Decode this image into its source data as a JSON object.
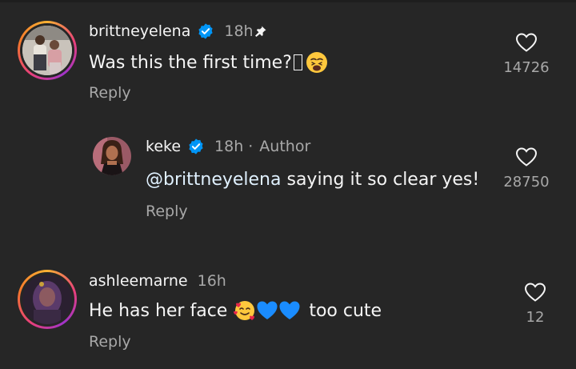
{
  "comments": [
    {
      "username": "brittneyelena",
      "verified": true,
      "time": "18h",
      "pinned": true,
      "text": "Was this the first time?",
      "reply_label": "Reply",
      "likes": "14726"
    },
    {
      "username": "keke",
      "verified": true,
      "time": "18h",
      "separator": "·",
      "author_label": "Author",
      "mention": "@brittneyelena",
      "text": " saying it so clear yes!",
      "reply_label": "Reply",
      "likes": "28750"
    },
    {
      "username": "ashleemarne",
      "verified": false,
      "time": "16h",
      "text_before": "He has her face",
      "text_after": "too cute",
      "reply_label": "Reply",
      "likes": "12"
    }
  ],
  "colors": {
    "background": "#262626",
    "text_primary": "#f5f5f5",
    "text_secondary": "#a8a8a8",
    "verified_blue": "#0095f6",
    "heart_blue": "#1a8cff"
  },
  "icons": {
    "verified": "verified-badge-icon",
    "pin": "pin-icon",
    "like": "heart-outline-icon",
    "emoji_weary": "weary-face-emoji",
    "emoji_hearts": "smiling-face-with-hearts-emoji",
    "emoji_blue_heart": "blue-heart-emoji"
  }
}
